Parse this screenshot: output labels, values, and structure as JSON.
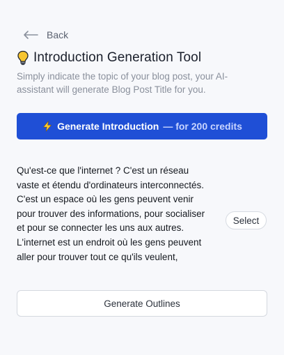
{
  "nav": {
    "back_label": "Back",
    "back_icon": "arrow-left-icon"
  },
  "header": {
    "icon": "lightbulb-icon",
    "title": "Introduction Generation Tool",
    "subtitle": "Simply indicate the topic of your blog post, your AI-assistant will generate Blog Post Title for you."
  },
  "generate_button": {
    "icon": "lightning-bolt-icon",
    "label": "Generate Introduction",
    "credits_label": "— for 200 credits",
    "color": "#1f4fd6"
  },
  "result": {
    "text": "Qu'est-ce que l'internet ? C'est un réseau vaste et étendu d'ordinateurs interconnectés. C'est un espace où les gens peuvent venir pour trouver des informations, pour socialiser et pour se connecter les uns aux autres. L'internet est un endroit où les gens peuvent aller pour trouver tout ce qu'ils veulent,",
    "select_label": "Select"
  },
  "outline_button": {
    "label": "Generate Outlines"
  }
}
